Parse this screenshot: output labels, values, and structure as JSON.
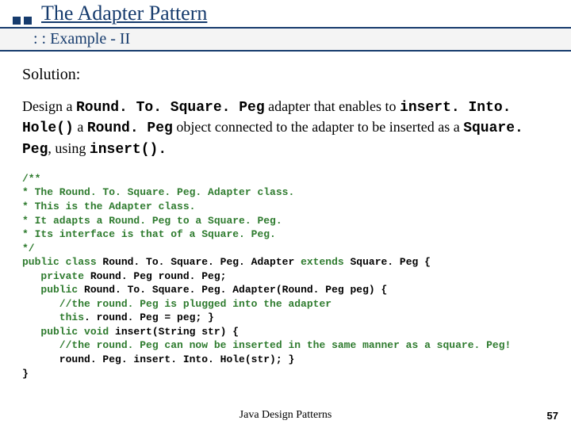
{
  "header": {
    "title": "The Adapter Pattern",
    "subtitle": ": : Example - II"
  },
  "body": {
    "solution_label": "Solution:",
    "para": {
      "t1": "Design a ",
      "cls_adapter": "Round. To. Square. Peg",
      "t2": " adapter that enables to ",
      "fn_insert_hole": "insert. Into. Hole()",
      "t3": " a ",
      "cls_roundpeg": "Round. Peg",
      "t4": " object connected to the adapter to be inserted as a ",
      "cls_squarepeg": "Square. Peg",
      "t5": ", using ",
      "fn_insert": "insert().",
      "t6": ""
    },
    "code": {
      "c01": "/**",
      "c02": "* The Round. To. Square. Peg. Adapter class.",
      "c03": "* This is the Adapter class.",
      "c04": "* It adapts a Round. Peg to a Square. Peg.",
      "c05": "* Its interface is that of a Square. Peg.",
      "c06": "*/",
      "c07a": "public class",
      "c07b": " Round. To. Square. Peg. Adapter ",
      "c07c": "extends",
      "c07d": " Square. Peg {",
      "c08a": "   private",
      "c08b": " Round. Peg round. Peg;",
      "c09a": "   public",
      "c09b": " Round. To. Square. Peg. Adapter(Round. Peg peg) {",
      "c10": "      //the round. Peg is plugged into the adapter",
      "c11a": "      this",
      "c11b": ". round. Peg = peg; }",
      "c12a": "   public void",
      "c12b": " insert(String str) {",
      "c13": "      //the round. Peg can now be inserted in the same manner as a square. Peg!",
      "c14": "      round. Peg. insert. Into. Hole(str); }",
      "c15": "}"
    }
  },
  "footer": {
    "center": "Java Design Patterns",
    "page": "57"
  }
}
